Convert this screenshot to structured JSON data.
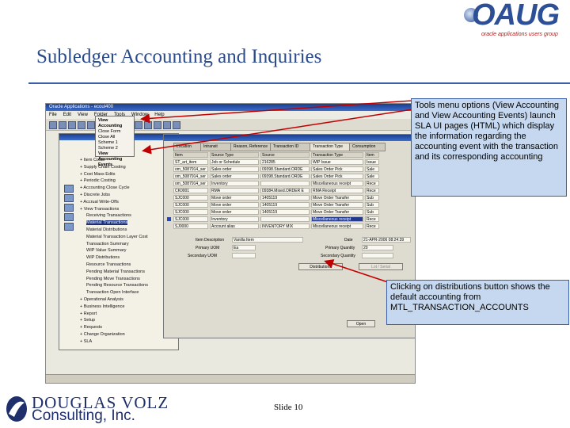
{
  "slide": {
    "title": "Subledger Accounting and Inquiries",
    "slide_number": "Slide 10"
  },
  "logos": {
    "oaug_text": "OAUG",
    "oaug_subtitle": "oracle applications users group",
    "company_line1": "DOUGLAS VOLZ",
    "company_line2": "Consulting, Inc."
  },
  "callouts": {
    "tools_menu": "Tools menu options (View Accounting and View Accounting Events) launch SLA UI pages (HTML) which display the information regarding the accounting event with the transaction and its corresponding accounting",
    "distributions": "Clicking on distributions button shows the default accounting from MTL_TRANSACTION_ACCOUNTS"
  },
  "app": {
    "window_title": "Oracle Applications - ecoul400",
    "menu": [
      "File",
      "Edit",
      "View",
      "Folder",
      "Tools",
      "Window",
      "Help"
    ],
    "tools_menu_items": [
      "View Accounting",
      "Close Form",
      "Close All",
      "Scheme 1",
      "Scheme 2",
      "View Accounting Events"
    ],
    "nav_items": [
      {
        "label": "Item Costs",
        "sel": false
      },
      {
        "label": "Supply Chain Costing",
        "sel": false
      },
      {
        "label": "Cost Mass Edits",
        "sel": false
      },
      {
        "label": "Periodic Costing",
        "sel": false
      },
      {
        "label": "Accounting Close Cycle",
        "sel": false
      },
      {
        "label": "Discrete Jobs",
        "sel": false
      },
      {
        "label": "Accrual Write-Offs",
        "sel": false
      },
      {
        "label": "View Transactions",
        "sel": false
      },
      {
        "label": "Receiving Transactions",
        "sel": false
      },
      {
        "label": "Material Transactions",
        "sel": true
      },
      {
        "label": "Material Distributions",
        "sel": false
      },
      {
        "label": "Material Transaction Layer Cost",
        "sel": false
      },
      {
        "label": "Transaction Summary",
        "sel": false
      },
      {
        "label": "WIP Value Summary",
        "sel": false
      },
      {
        "label": "WIP Distributions",
        "sel": false
      },
      {
        "label": "Resource Transactions",
        "sel": false
      },
      {
        "label": "Pending Material Transactions",
        "sel": false
      },
      {
        "label": "Pending Move Transactions",
        "sel": false
      },
      {
        "label": "Pending Resource Transactions",
        "sel": false
      },
      {
        "label": "Transaction Open Interface",
        "sel": false
      },
      {
        "label": "Operational Analysis",
        "sel": false
      },
      {
        "label": "Business Intelligence",
        "sel": false
      },
      {
        "label": "Report",
        "sel": false
      },
      {
        "label": "Setup",
        "sel": false
      },
      {
        "label": "Requests",
        "sel": false
      },
      {
        "label": "Change Organization",
        "sel": false
      },
      {
        "label": "SLA",
        "sel": false
      }
    ],
    "tabs": [
      "Location",
      "Intransit",
      "Reason, Reference",
      "Transaction ID",
      "Transaction Type",
      "Consumption"
    ],
    "columns": [
      "Item",
      "Source Type",
      "Source",
      "Transaction Type",
      "Item"
    ],
    "rows": [
      [
        "ST_art_item",
        "Job or Schedule",
        "216285",
        "WIP Issue",
        "Issue"
      ],
      [
        "om_5087914_ser",
        "Sales order",
        "09398.Standard.ORDE",
        "Sales Order Pick",
        "Sale"
      ],
      [
        "om_5087914_ser",
        "Sales order",
        "09398.Standard.ORDE",
        "Sales Order Pick",
        "Sale"
      ],
      [
        "om_5087914_ser",
        "Inventory",
        "",
        "Miscellaneous receipt",
        "Rece"
      ],
      [
        "CK0001",
        "RMA",
        "09384.Mixed.ORDER E",
        "RMA Receipt",
        "Rece"
      ],
      [
        "SJC000",
        "Move order",
        "1405119",
        "Move Order Transfer",
        "Sub"
      ],
      [
        "SJC000",
        "Move order",
        "1405119",
        "Move Order Transfer",
        "Sub"
      ],
      [
        "SJC000",
        "Move order",
        "1405119",
        "Move Order Transfer",
        "Sub"
      ],
      [
        "SJC000",
        "Inventory",
        "",
        "Miscellaneous receipt",
        "Rece"
      ],
      [
        "SJ0000",
        "Account alias",
        "INVENTORY MIX",
        "Miscellaneous receipt",
        "Rece"
      ]
    ],
    "detail": {
      "item_desc_label": "Item Description",
      "item_desc_value": "Vanilla Item",
      "primary_uom_label": "Primary UOM",
      "primary_uom_value": "Ea",
      "secondary_uom_label": "Secondary UOM",
      "date_label": "Date",
      "date_value": "21-APR-2006 08:24:39",
      "primary_qty_label": "Primary Quantity",
      "primary_qty_value": "20",
      "secondary_qty_label": "Secondary Quantity",
      "distributions_button": "Distributions",
      "lot_serial_button": "Lot / Serial",
      "open_button": "Open"
    }
  }
}
